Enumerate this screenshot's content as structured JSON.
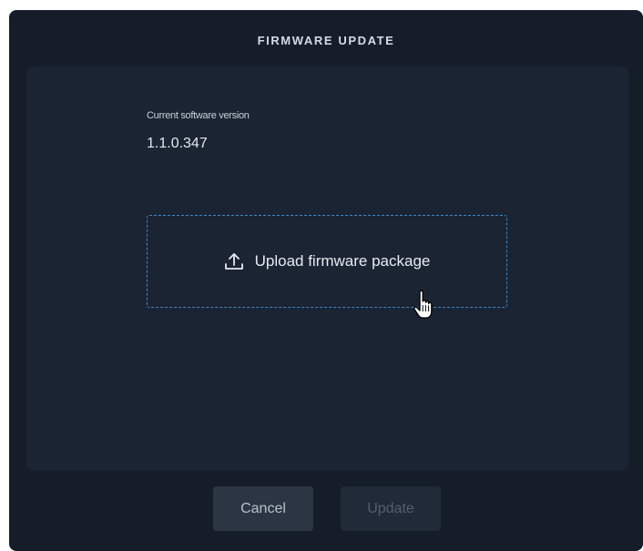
{
  "dialog": {
    "title": "FIRMWARE UPDATE"
  },
  "software": {
    "label": "Current software version",
    "version": "1.1.0.347"
  },
  "upload": {
    "label": "Upload firmware package",
    "icon": "upload-icon"
  },
  "footer": {
    "cancel_label": "Cancel",
    "update_label": "Update",
    "update_disabled": true
  },
  "colors": {
    "dialog_bg": "#151d29",
    "panel_bg": "#1b2433",
    "dashed_border": "#3f86c4",
    "text_primary": "#e7ebf1"
  }
}
